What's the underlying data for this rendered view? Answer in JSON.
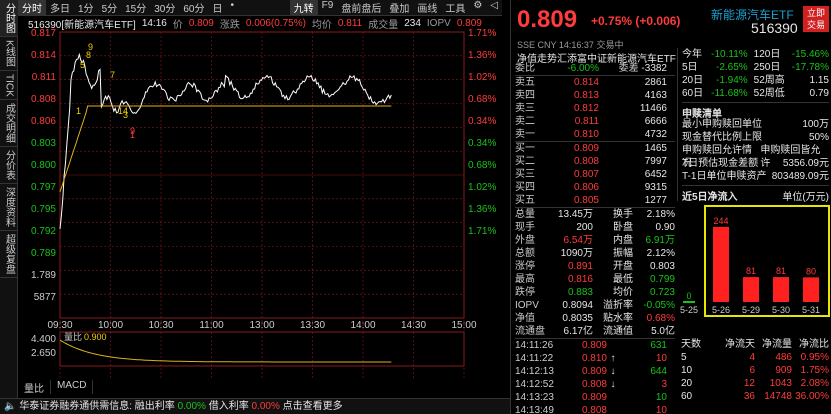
{
  "side_tabs": [
    {
      "label": "分时图",
      "active": true
    },
    {
      "label": "K线图",
      "active": false
    },
    {
      "label": "TICK",
      "active": false
    },
    {
      "label": "成交明细",
      "active": false
    },
    {
      "label": "分价表",
      "active": false
    },
    {
      "label": "深度资料",
      "active": false
    },
    {
      "label": "超级复盘",
      "active": false
    }
  ],
  "toolbar": {
    "left_items": [
      "分时",
      "多日",
      "1分",
      "5分",
      "15分",
      "30分",
      "60分",
      "日",
      "•"
    ],
    "right_items": [
      "九转",
      "F9",
      "盘前盘后",
      "叠加",
      "画线",
      "工具",
      "⚙",
      "◁"
    ]
  },
  "info_line": {
    "code_name": "516390[新能源汽车ETF]",
    "time": "14:16",
    "price_label": "价",
    "price": "0.809",
    "change_label": "涨跌",
    "change": "0.006(0.75%)",
    "avg_label": "均价",
    "avg": "0.811",
    "volume_label": "成交量",
    "volume": "234",
    "iopv_label": "IOPV",
    "iopv": "0.809"
  },
  "chart": {
    "price_axis": [
      "0.817",
      "0.814",
      "0.811",
      "0.808",
      "0.806",
      "0.803",
      "0.800",
      "0.797",
      "0.795",
      "0.792",
      "0.789",
      "1.789",
      "5877"
    ],
    "pct_axis": [
      "1.71%",
      "1.36%",
      "1.02%",
      "0.68%",
      "0.34%",
      "0.34%",
      "0.68%",
      "1.02%",
      "1.36%",
      "1.71%"
    ],
    "time_axis": [
      "09:30",
      "10:00",
      "10:30",
      "11:00",
      "13:00",
      "13:30",
      "14:00",
      "14:30",
      "15:00"
    ],
    "markers": [
      "5",
      "8",
      "9",
      "7",
      "1",
      "14",
      "3",
      "9",
      "1"
    ],
    "vol_axis": [
      "4.400",
      "2.650"
    ],
    "ratio_label": "量比",
    "ratio_value": "0.900",
    "bottom_tabs": [
      "量比",
      "MACD"
    ]
  },
  "ticker": {
    "label": "华泰证券融券通供需信息:",
    "loan_rate_label": "融出利率",
    "loan_rate": "0.00%",
    "borrow_rate_label": "借入利率",
    "borrow_rate": "0.00%",
    "link": "点击查看更多"
  },
  "quote": {
    "price": "0.809",
    "change": "+0.75%",
    "change_abs": "(+0.006)",
    "name": "新能源汽车ETF",
    "code": "516390",
    "tag1": "立即",
    "tag2": "交易",
    "exchange": "SSE",
    "currency": "CNY",
    "datetime": "14:16:37",
    "status": "交易中",
    "etf_full": "净值走势汇添富中证新能源汽车ETF",
    "commit_ratio_label": "委比",
    "commit_ratio": "-6.00%",
    "commit_diff_label": "委差",
    "commit_diff": "-3382"
  },
  "asks": [
    {
      "label": "卖五",
      "price": "0.814",
      "vol": "2861"
    },
    {
      "label": "卖四",
      "price": "0.813",
      "vol": "4163"
    },
    {
      "label": "卖三",
      "price": "0.812",
      "vol": "11466"
    },
    {
      "label": "卖二",
      "price": "0.811",
      "vol": "6666"
    },
    {
      "label": "卖一",
      "price": "0.810",
      "vol": "4732"
    }
  ],
  "bids": [
    {
      "label": "买一",
      "price": "0.809",
      "vol": "1465"
    },
    {
      "label": "买二",
      "price": "0.808",
      "vol": "7997"
    },
    {
      "label": "买三",
      "price": "0.807",
      "vol": "6452"
    },
    {
      "label": "买四",
      "price": "0.806",
      "vol": "9315"
    },
    {
      "label": "买五",
      "price": "0.805",
      "vol": "1277"
    }
  ],
  "stats": [
    [
      "总量",
      "13.45万",
      "white",
      "换手",
      "2.18%",
      "white"
    ],
    [
      "现手",
      "200",
      "white",
      "卧盘",
      "0.90",
      "white"
    ],
    [
      "外盘",
      "6.54万",
      "red",
      "内盘",
      "6.91万",
      "green"
    ],
    [
      "总额",
      "1090万",
      "white",
      "振幅",
      "2.12%",
      "white"
    ],
    [
      "涨停",
      "0.891",
      "red",
      "开盘",
      "0.803",
      "white"
    ],
    [
      "最高",
      "0.816",
      "red",
      "最低",
      "0.799",
      "green"
    ],
    [
      "跌停",
      "0.883",
      "green",
      "均价",
      "0.723",
      "green"
    ],
    [
      "IOPV",
      "0.8094",
      "white",
      "溢折率",
      "-0.05%",
      "green"
    ],
    [
      "净值",
      "0.8035",
      "white",
      "贴水率",
      "0.68%",
      "red"
    ],
    [
      "流通盘",
      "6.17亿",
      "white",
      "流通值",
      "5.0亿",
      "white"
    ]
  ],
  "trades": [
    {
      "time": "14:11:26",
      "price": "0.809",
      "vol": "631",
      "dir": "",
      "color": "red"
    },
    {
      "time": "14:11:22",
      "price": "0.810",
      "vol": "10",
      "dir": "↑",
      "color": "red"
    },
    {
      "time": "14:12:13",
      "price": "0.809",
      "vol": "644",
      "dir": "↓",
      "color": "red"
    },
    {
      "time": "14:12:52",
      "price": "0.808",
      "vol": "3",
      "dir": "↓",
      "color": "red"
    },
    {
      "time": "14:13:23",
      "price": "0.809",
      "vol": "10",
      "dir": "",
      "color": "red"
    },
    {
      "time": "14:13:49",
      "price": "0.808",
      "vol": "10",
      "dir": "",
      "color": "red"
    }
  ],
  "perf": [
    [
      "今年",
      "-10.11%",
      "120日",
      "-15.46%"
    ],
    [
      "5日",
      "-2.65%",
      "250日",
      "-17.78%"
    ],
    [
      "20日",
      "-1.94%",
      "52周高",
      "1.15"
    ],
    [
      "60日",
      "-11.68%",
      "52周低",
      "0.79"
    ]
  ],
  "redemption": {
    "title": "申赎清单",
    "rows": [
      [
        "最小申购赎回单位",
        "100万"
      ],
      [
        "现金替代比例上限",
        "50%"
      ],
      [
        "申购赎回允许情况",
        "申购赎回皆允许"
      ],
      [
        "T日预估现金差额",
        "5356.09元"
      ],
      [
        "T-1日单位申赎资产",
        "803489.09元"
      ]
    ]
  },
  "inflow": {
    "title": "近5日净流入",
    "unit": "单位(万元)",
    "dates": [
      "5-25",
      "5-26",
      "5-29",
      "5-30",
      "5-31"
    ],
    "values": [
      0,
      244,
      81,
      81,
      80
    ]
  },
  "flow_table": {
    "headers": [
      "天数",
      "净流天",
      "净流量",
      "净流比"
    ],
    "rows": [
      [
        "5",
        "4",
        "486",
        "0.95%"
      ],
      [
        "10",
        "6",
        "909",
        "1.75%"
      ],
      [
        "20",
        "12",
        "1043",
        "2.08%"
      ],
      [
        "60",
        "36",
        "14748",
        "36.00%"
      ]
    ]
  },
  "colors": {
    "up": "#ff3b3b",
    "down": "#19c219",
    "price_line": "#ffffff",
    "avg_line": "#e0b020",
    "highlight": "#e6e600"
  }
}
